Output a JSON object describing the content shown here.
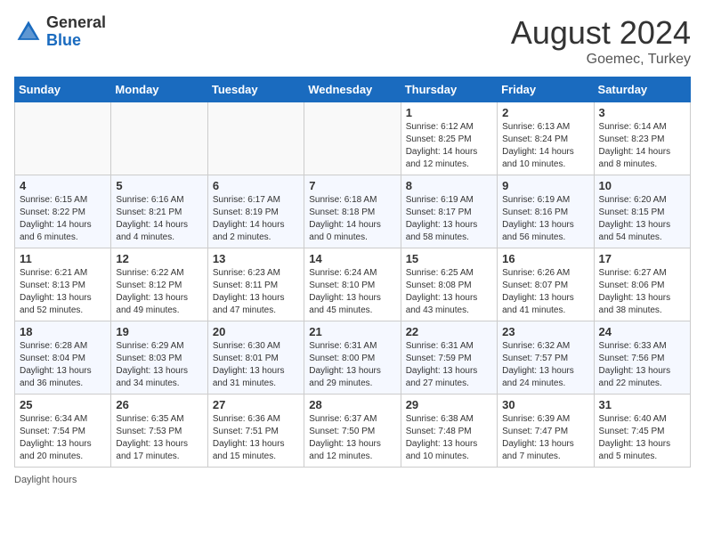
{
  "header": {
    "logo_general": "General",
    "logo_blue": "Blue",
    "title": "August 2024",
    "subtitle": "Goemec, Turkey"
  },
  "days_of_week": [
    "Sunday",
    "Monday",
    "Tuesday",
    "Wednesday",
    "Thursday",
    "Friday",
    "Saturday"
  ],
  "weeks": [
    [
      {
        "day": "",
        "info": ""
      },
      {
        "day": "",
        "info": ""
      },
      {
        "day": "",
        "info": ""
      },
      {
        "day": "",
        "info": ""
      },
      {
        "day": "1",
        "info": "Sunrise: 6:12 AM\nSunset: 8:25 PM\nDaylight: 14 hours and 12 minutes."
      },
      {
        "day": "2",
        "info": "Sunrise: 6:13 AM\nSunset: 8:24 PM\nDaylight: 14 hours and 10 minutes."
      },
      {
        "day": "3",
        "info": "Sunrise: 6:14 AM\nSunset: 8:23 PM\nDaylight: 14 hours and 8 minutes."
      }
    ],
    [
      {
        "day": "4",
        "info": "Sunrise: 6:15 AM\nSunset: 8:22 PM\nDaylight: 14 hours and 6 minutes."
      },
      {
        "day": "5",
        "info": "Sunrise: 6:16 AM\nSunset: 8:21 PM\nDaylight: 14 hours and 4 minutes."
      },
      {
        "day": "6",
        "info": "Sunrise: 6:17 AM\nSunset: 8:19 PM\nDaylight: 14 hours and 2 minutes."
      },
      {
        "day": "7",
        "info": "Sunrise: 6:18 AM\nSunset: 8:18 PM\nDaylight: 14 hours and 0 minutes."
      },
      {
        "day": "8",
        "info": "Sunrise: 6:19 AM\nSunset: 8:17 PM\nDaylight: 13 hours and 58 minutes."
      },
      {
        "day": "9",
        "info": "Sunrise: 6:19 AM\nSunset: 8:16 PM\nDaylight: 13 hours and 56 minutes."
      },
      {
        "day": "10",
        "info": "Sunrise: 6:20 AM\nSunset: 8:15 PM\nDaylight: 13 hours and 54 minutes."
      }
    ],
    [
      {
        "day": "11",
        "info": "Sunrise: 6:21 AM\nSunset: 8:13 PM\nDaylight: 13 hours and 52 minutes."
      },
      {
        "day": "12",
        "info": "Sunrise: 6:22 AM\nSunset: 8:12 PM\nDaylight: 13 hours and 49 minutes."
      },
      {
        "day": "13",
        "info": "Sunrise: 6:23 AM\nSunset: 8:11 PM\nDaylight: 13 hours and 47 minutes."
      },
      {
        "day": "14",
        "info": "Sunrise: 6:24 AM\nSunset: 8:10 PM\nDaylight: 13 hours and 45 minutes."
      },
      {
        "day": "15",
        "info": "Sunrise: 6:25 AM\nSunset: 8:08 PM\nDaylight: 13 hours and 43 minutes."
      },
      {
        "day": "16",
        "info": "Sunrise: 6:26 AM\nSunset: 8:07 PM\nDaylight: 13 hours and 41 minutes."
      },
      {
        "day": "17",
        "info": "Sunrise: 6:27 AM\nSunset: 8:06 PM\nDaylight: 13 hours and 38 minutes."
      }
    ],
    [
      {
        "day": "18",
        "info": "Sunrise: 6:28 AM\nSunset: 8:04 PM\nDaylight: 13 hours and 36 minutes."
      },
      {
        "day": "19",
        "info": "Sunrise: 6:29 AM\nSunset: 8:03 PM\nDaylight: 13 hours and 34 minutes."
      },
      {
        "day": "20",
        "info": "Sunrise: 6:30 AM\nSunset: 8:01 PM\nDaylight: 13 hours and 31 minutes."
      },
      {
        "day": "21",
        "info": "Sunrise: 6:31 AM\nSunset: 8:00 PM\nDaylight: 13 hours and 29 minutes."
      },
      {
        "day": "22",
        "info": "Sunrise: 6:31 AM\nSunset: 7:59 PM\nDaylight: 13 hours and 27 minutes."
      },
      {
        "day": "23",
        "info": "Sunrise: 6:32 AM\nSunset: 7:57 PM\nDaylight: 13 hours and 24 minutes."
      },
      {
        "day": "24",
        "info": "Sunrise: 6:33 AM\nSunset: 7:56 PM\nDaylight: 13 hours and 22 minutes."
      }
    ],
    [
      {
        "day": "25",
        "info": "Sunrise: 6:34 AM\nSunset: 7:54 PM\nDaylight: 13 hours and 20 minutes."
      },
      {
        "day": "26",
        "info": "Sunrise: 6:35 AM\nSunset: 7:53 PM\nDaylight: 13 hours and 17 minutes."
      },
      {
        "day": "27",
        "info": "Sunrise: 6:36 AM\nSunset: 7:51 PM\nDaylight: 13 hours and 15 minutes."
      },
      {
        "day": "28",
        "info": "Sunrise: 6:37 AM\nSunset: 7:50 PM\nDaylight: 13 hours and 12 minutes."
      },
      {
        "day": "29",
        "info": "Sunrise: 6:38 AM\nSunset: 7:48 PM\nDaylight: 13 hours and 10 minutes."
      },
      {
        "day": "30",
        "info": "Sunrise: 6:39 AM\nSunset: 7:47 PM\nDaylight: 13 hours and 7 minutes."
      },
      {
        "day": "31",
        "info": "Sunrise: 6:40 AM\nSunset: 7:45 PM\nDaylight: 13 hours and 5 minutes."
      }
    ]
  ],
  "footer": {
    "label": "Daylight hours"
  }
}
